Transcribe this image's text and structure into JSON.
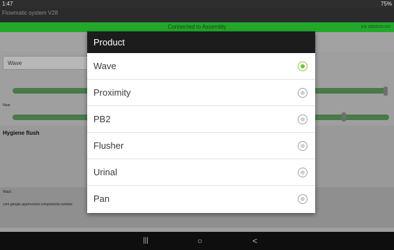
{
  "status_bar": {
    "time": "1:47",
    "right_text": "75%"
  },
  "app": {
    "title": "Flowmatic system V28",
    "connection_status": "Connected to Assembly",
    "version_label": "EIK 18032018.V02",
    "product_select": "Wave",
    "near_label": "Near",
    "hygiene_title": "Hygiene flush",
    "log_line1": "Wap1",
    "log_line2": "com.google.appinventor.components.runtime"
  },
  "dialog": {
    "title": "Product",
    "options": [
      {
        "label": "Wave",
        "selected": true
      },
      {
        "label": "Proximity",
        "selected": false
      },
      {
        "label": "PB2",
        "selected": false
      },
      {
        "label": "Flusher",
        "selected": false
      },
      {
        "label": "Urinal",
        "selected": false
      },
      {
        "label": "Pan",
        "selected": false
      }
    ]
  },
  "navbar": {
    "recent": "|||",
    "home": "○",
    "back": "<"
  },
  "colors": {
    "accent_green": "#22a92a",
    "radio_selected": "#7cbd3a",
    "dialog_header": "#1c1c1c"
  }
}
